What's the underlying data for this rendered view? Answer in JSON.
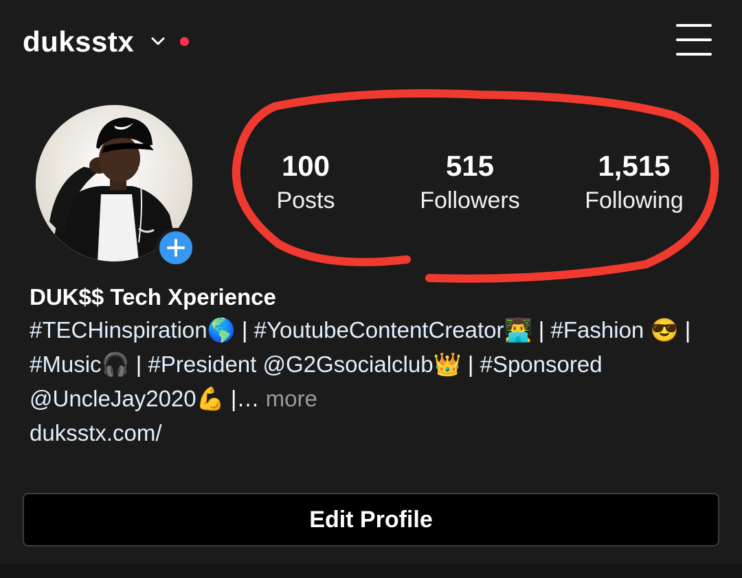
{
  "header": {
    "username": "duksstx",
    "account_switch_icon": "chevron-down-icon",
    "notification_dot_color": "#ff3150",
    "menu_icon": "hamburger-menu-icon"
  },
  "profile": {
    "avatar": "profile-photo",
    "add_story_icon": "plus-icon",
    "stats": [
      {
        "count": "100",
        "label": "Posts"
      },
      {
        "count": "515",
        "label": "Followers"
      },
      {
        "count": "1,515",
        "label": "Following"
      }
    ],
    "highlight_color": "#f03a30"
  },
  "bio": {
    "full_name": "DUK$$ Tech Xperience",
    "line_tech": "#TECHinspiration",
    "emoji_globe": "🌎",
    "sep": "|",
    "line_youtube": "#YoutubeContentCreator",
    "emoji_laptop": "👨‍💻",
    "line_fashion": "#Fashion",
    "emoji_sunglasses": "😎",
    "line_music": "#Music",
    "emoji_headphones": "🎧",
    "line_president": "#President @G2Gsocialclub",
    "emoji_crown": "👑",
    "line_sponsored": "#Sponsored",
    "line_unclejay": "@UncleJay2020",
    "emoji_muscle": "💪",
    "ellipsis": "|…",
    "more_label": "more",
    "website": "duksstx.com/"
  },
  "actions": {
    "edit_profile_label": "Edit Profile"
  }
}
